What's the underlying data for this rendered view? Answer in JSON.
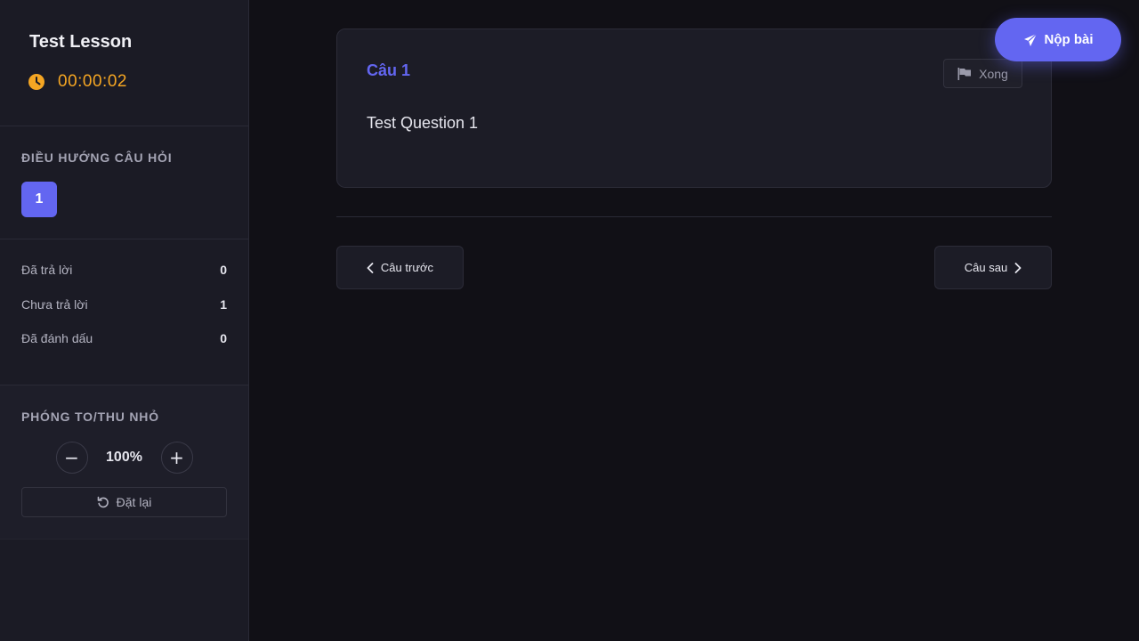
{
  "sidebar": {
    "lesson_title": "Test Lesson",
    "timer": "00:00:02",
    "timer_color": "#f5a623",
    "nav_title": "ĐIỀU HƯỚNG CÂU HỎI",
    "questions": [
      "1"
    ],
    "stats": [
      {
        "label": "Đã trả lời",
        "value": "0"
      },
      {
        "label": "Chưa trả lời",
        "value": "1"
      },
      {
        "label": "Đã đánh dấu",
        "value": "0"
      }
    ],
    "zoom_title": "PHÓNG TO/THU NHỎ",
    "zoom_out": "−",
    "zoom_value": "100%",
    "zoom_in": "+",
    "reset_label": "Đặt lại"
  },
  "question": {
    "label": "Câu 1",
    "flag_label": "Xong",
    "text": "Test Question 1"
  },
  "nav": {
    "prev_label": "Câu trước",
    "next_label": "Câu sau"
  },
  "submit_label": "Nộp bài",
  "colors": {
    "accent": "#6366f1",
    "background": "#111016",
    "sidebar": "#1b1b25"
  },
  "icons": {
    "timer": "clock-icon",
    "flag": "flag-icon",
    "reset": "rotate-left-icon",
    "submit": "paper-plane-icon",
    "prev": "chevron-left-icon",
    "next": "chevron-right-icon"
  }
}
